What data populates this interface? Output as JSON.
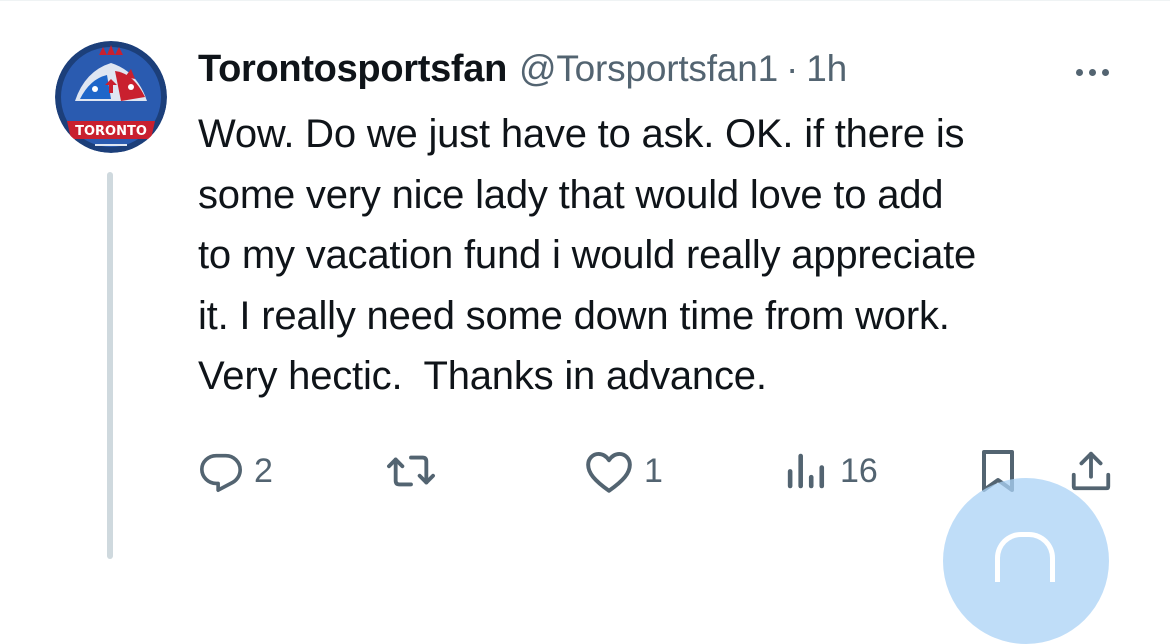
{
  "tweet": {
    "display_name": "Torontosportsfan",
    "handle": "@Torsportsfan1",
    "separator": "·",
    "time": "1h",
    "text_lines": [
      "Wow. Do we just have to ask. OK. if there is",
      "some very nice lady that would love to add",
      "to my vacation fund i would really appreciate",
      "it. I really need some down time from work.",
      "Very hectic.  Thanks in advance."
    ],
    "avatar_text": "TORONTO"
  },
  "actions": {
    "reply_count": "2",
    "retweet_count": "",
    "like_count": "1",
    "views_count": "16"
  },
  "icons": {
    "reply": "reply-icon",
    "retweet": "retweet-icon",
    "like": "like-icon",
    "views": "views-icon",
    "bookmark": "bookmark-icon",
    "share": "share-icon",
    "more": "more-icon",
    "compose": "compose-icon"
  },
  "colors": {
    "text_primary": "#0f1419",
    "text_secondary": "#536471",
    "thread_line": "#cfd9de",
    "fab": "#a9d2f5"
  }
}
